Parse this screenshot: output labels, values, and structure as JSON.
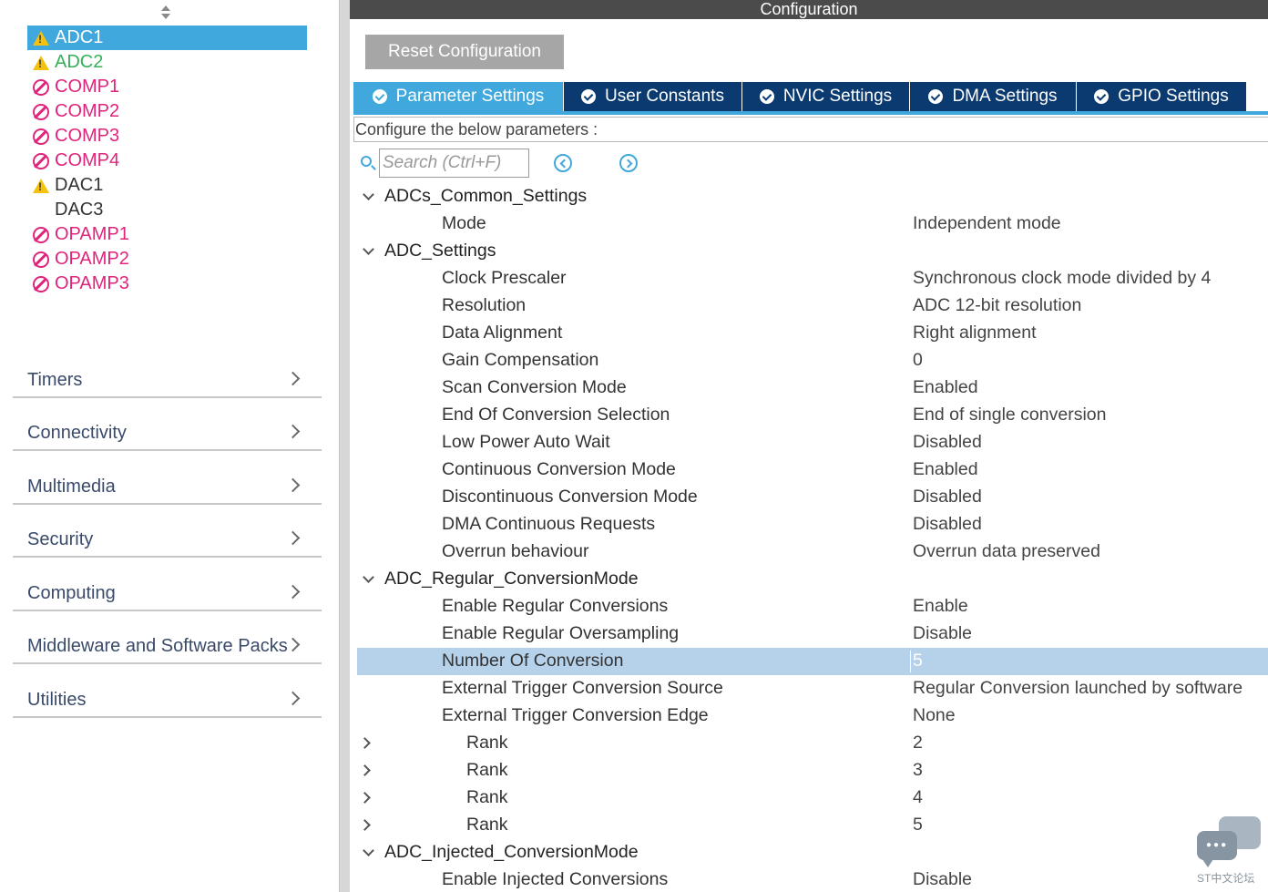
{
  "left_panel": {
    "peripherals": [
      {
        "label": "ADC1",
        "icon": "warning-icon",
        "status": "warning",
        "selected": true
      },
      {
        "label": "ADC2",
        "icon": "warning-icon",
        "status": "warning-green",
        "selected": false
      },
      {
        "label": "COMP1",
        "icon": "disabled-icon",
        "status": "disabled",
        "selected": false
      },
      {
        "label": "COMP2",
        "icon": "disabled-icon",
        "status": "disabled",
        "selected": false
      },
      {
        "label": "COMP3",
        "icon": "disabled-icon",
        "status": "disabled",
        "selected": false
      },
      {
        "label": "COMP4",
        "icon": "disabled-icon",
        "status": "disabled",
        "selected": false
      },
      {
        "label": "DAC1",
        "icon": "warning-icon",
        "status": "warning-dark",
        "selected": false
      },
      {
        "label": "DAC3",
        "icon": "",
        "status": "normal",
        "selected": false
      },
      {
        "label": "OPAMP1",
        "icon": "disabled-icon",
        "status": "disabled",
        "selected": false
      },
      {
        "label": "OPAMP2",
        "icon": "disabled-icon",
        "status": "disabled",
        "selected": false
      },
      {
        "label": "OPAMP3",
        "icon": "disabled-icon",
        "status": "disabled",
        "selected": false
      }
    ],
    "categories": [
      "Timers",
      "Connectivity",
      "Multimedia",
      "Security",
      "Computing",
      "Middleware and Software Packs",
      "Utilities"
    ]
  },
  "right_panel": {
    "title": "Configuration",
    "reset_button": "Reset Configuration",
    "tabs": [
      {
        "label": "Parameter Settings",
        "active": true
      },
      {
        "label": "User Constants",
        "active": false
      },
      {
        "label": "NVIC Settings",
        "active": false
      },
      {
        "label": "DMA Settings",
        "active": false
      },
      {
        "label": "GPIO Settings",
        "active": false
      }
    ],
    "configure_text": "Configure the below parameters :",
    "search": {
      "placeholder": "Search (Ctrl+F)"
    },
    "tree": [
      {
        "kind": "group",
        "label": "ADCs_Common_Settings",
        "value": "",
        "toggle": "expanded"
      },
      {
        "kind": "leaf",
        "label": "Mode",
        "value": "Independent mode"
      },
      {
        "kind": "group",
        "label": "ADC_Settings",
        "value": "",
        "toggle": "expanded"
      },
      {
        "kind": "leaf",
        "label": "Clock Prescaler",
        "value": "Synchronous clock mode divided by 4"
      },
      {
        "kind": "leaf",
        "label": "Resolution",
        "value": "ADC 12-bit resolution"
      },
      {
        "kind": "leaf",
        "label": "Data Alignment",
        "value": "Right alignment"
      },
      {
        "kind": "leaf",
        "label": "Gain Compensation",
        "value": "0"
      },
      {
        "kind": "leaf",
        "label": "Scan Conversion Mode",
        "value": "Enabled"
      },
      {
        "kind": "leaf",
        "label": "End Of Conversion Selection",
        "value": "End of single conversion"
      },
      {
        "kind": "leaf",
        "label": "Low Power Auto Wait",
        "value": "Disabled"
      },
      {
        "kind": "leaf",
        "label": "Continuous Conversion Mode",
        "value": "Enabled"
      },
      {
        "kind": "leaf",
        "label": "Discontinuous Conversion Mode",
        "value": "Disabled"
      },
      {
        "kind": "leaf",
        "label": "DMA Continuous Requests",
        "value": "Disabled"
      },
      {
        "kind": "leaf",
        "label": "Overrun behaviour",
        "value": "Overrun data preserved"
      },
      {
        "kind": "group",
        "label": "ADC_Regular_ConversionMode",
        "value": "",
        "toggle": "expanded"
      },
      {
        "kind": "leaf",
        "label": "Enable Regular Conversions",
        "value": "Enable"
      },
      {
        "kind": "leaf",
        "label": "Enable Regular Oversampling",
        "value": "Disable"
      },
      {
        "kind": "leaf",
        "label": "Number Of Conversion",
        "value": "5",
        "selected": true
      },
      {
        "kind": "leaf",
        "label": "External Trigger Conversion Source",
        "value": "Regular Conversion launched by software"
      },
      {
        "kind": "leaf",
        "label": "External Trigger Conversion Edge",
        "value": "None"
      },
      {
        "kind": "sub",
        "label": "Rank",
        "value": "2",
        "toggle": "collapsed"
      },
      {
        "kind": "sub",
        "label": "Rank",
        "value": "3",
        "toggle": "collapsed"
      },
      {
        "kind": "sub",
        "label": "Rank",
        "value": "4",
        "toggle": "collapsed"
      },
      {
        "kind": "sub",
        "label": "Rank",
        "value": "5",
        "toggle": "collapsed"
      },
      {
        "kind": "group",
        "label": "ADC_Injected_ConversionMode",
        "value": "",
        "toggle": "expanded"
      },
      {
        "kind": "leaf",
        "label": "Enable Injected Conversions",
        "value": "Disable"
      }
    ]
  },
  "watermark": {
    "text": "ST中文论坛",
    "icon": "chat-bubbles-icon"
  },
  "colors": {
    "selection_blue": "#40a8dc",
    "tab_navy": "#0b3a70",
    "row_highlight": "#b5d2ea",
    "warning_yellow": "#f4c20d",
    "disabled_pink": "#e0247c",
    "ok_green": "#35b05a",
    "titlebar": "#4b4b4b"
  }
}
